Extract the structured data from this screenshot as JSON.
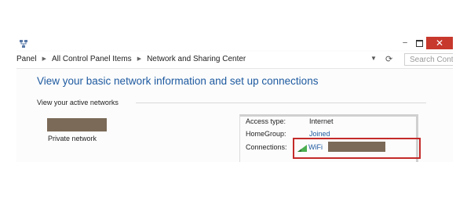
{
  "window": {
    "titlebar": {
      "minimize_label": "–",
      "close_label": "✕"
    },
    "address": {
      "breadcrumbs": [
        "Panel",
        "All Control Panel Items",
        "Network and Sharing Center"
      ],
      "search_placeholder": "Search Cont"
    },
    "main": {
      "title": "View your basic network information and set up connections",
      "active_networks_label": "View your active networks",
      "network": {
        "type_label": "Private network",
        "access_type_label": "Access type:",
        "access_type_value": "Internet",
        "homegroup_label": "HomeGroup:",
        "homegroup_value": "Joined",
        "connections_label": "Connections:",
        "connection_value": "WiFi"
      }
    }
  },
  "icons": {
    "system_menu": "network-icon",
    "address_dropdown": "chevron-down-icon",
    "refresh": "refresh-icon",
    "connection": "wifi-signal-icon"
  },
  "colors": {
    "link": "#1e5aa0",
    "close_button": "#c7382d",
    "highlight_border": "#c42a2a",
    "redaction": "#7b6a58"
  }
}
